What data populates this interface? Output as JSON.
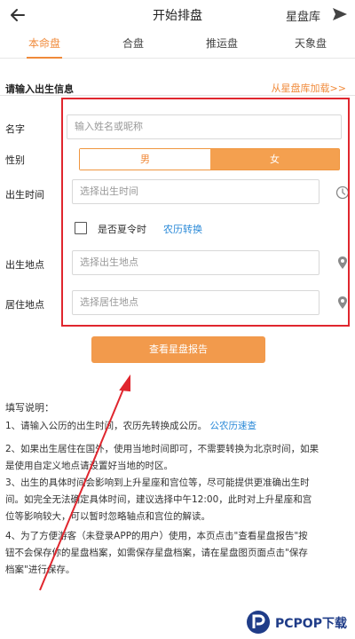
{
  "header": {
    "title": "开始排盘",
    "library_label": "星盘库"
  },
  "tabs": [
    {
      "label": "本命盘",
      "active": true
    },
    {
      "label": "合盘",
      "active": false
    },
    {
      "label": "推运盘",
      "active": false
    },
    {
      "label": "天象盘",
      "active": false
    }
  ],
  "form": {
    "section_title": "请输入出生信息",
    "load_from_library": "从星盘库加载>>",
    "name_label": "名字",
    "name_placeholder": "输入姓名或昵称",
    "gender_label": "性别",
    "gender_male": "男",
    "gender_female": "女",
    "gender_selected": "女",
    "birth_time_label": "出生时间",
    "birth_time_placeholder": "选择出生时间",
    "dst_label": "是否夏令时",
    "dst_checked": false,
    "lunar_convert": "农历转换",
    "birth_place_label": "出生地点",
    "birth_place_placeholder": "选择出生地点",
    "residence_label": "居住地点",
    "residence_placeholder": "选择居住地点",
    "submit_label": "查看星盘报告"
  },
  "notes": {
    "title": "填写说明：",
    "item1_text": "1、请输入公历的出生时间，农历先转换成公历。",
    "item1_link": "公农历速查",
    "item2_line1": "2、如果出生居住在国外，使用当地时间即可，不需要转换为北京时间，如果",
    "item2_line2": "是使用自定义地点请设置好当地的时区。",
    "item3_line1": "3、出生的具体时间会影响到上升星座和宫位等，尽可能提供更准确出生时",
    "item3_line2": "间。如完全无法确定具体时间，建议选择中午12:00，此时对上升星座和宫",
    "item3_line3": "位等影响较大，可以暂时忽略轴点和宫位的解读。",
    "item4_line1": "4、为了方便游客（未登录APP的用户）使用，本页点击\"查看星盘报告\"按",
    "item4_line2": "钮不会保存你的星盘档案，如需保存星盘档案，请在星盘图页面点击\"保存",
    "item4_line3": "档案\"进行保存。"
  },
  "watermark": {
    "text": "PCPOP下载"
  },
  "colors": {
    "accent": "#f08a3a",
    "button": "#f29a4c",
    "link": "#2b8ad8",
    "annotation_red": "#e0262e"
  }
}
